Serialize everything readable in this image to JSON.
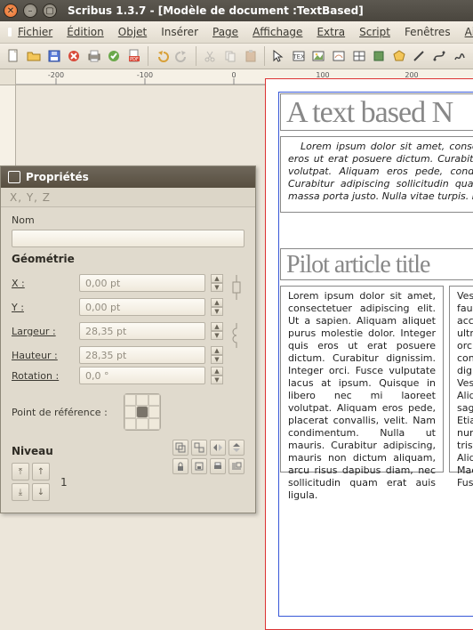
{
  "window": {
    "title": "Scribus 1.3.7 - [Modèle de document :TextBased]"
  },
  "menu": {
    "file": "Fichier",
    "edit": "Édition",
    "obj": "Objet",
    "insert": "Insérer",
    "page": "Page",
    "display": "Affichage",
    "extra": "Extra",
    "script": "Script",
    "windows": "Fenêtres",
    "help": "Aide"
  },
  "ruler": {
    "h": [
      "-200",
      "-100",
      "0",
      "100",
      "200"
    ]
  },
  "doc": {
    "heading": "A text based N",
    "intro": "Lorem ipsum dolor sit amet, consectetuer adipiscing elit, quis eros ut erat posuere dictum. Curabitur dignissim, nec mi laoreet volutpat. Aliquam eros pede, condimentum. Nulla ut mauris. Curabitur adipiscing sollicitudin quam erat quis ligula. Aenean massa porta justo. Nulla vitae turpis. Praesent lacus.",
    "h2": "Pilot article title",
    "col1": "Lorem ipsum dolor sit amet, consectetuer adipiscing elit. Ut a sapien. Aliquam aliquet purus molestie dolor. Integer quis eros ut erat posuere dictum. Curabitur dignissim. Integer orci. Fusce vulputate lacus at ipsum.  Quisque in libero nec mi laoreet volutpat. Aliquam eros pede, placerat convallis, velit. Nam condimentum. Nulla ut mauris. Curabitur adipiscing, mauris non dictum aliquam, arcu risus dapibus diam, nec sollicitudin quam erat auis ligula.",
    "col2": "Vestibulum in faucibus lorem accumsan ultricies mattis orci ut tristique consequat dignissim. Fusce  Vestibulum velit. Aliquam sed, sagittis nibh leo. Etiam hendrerit nunc. Vivamus tristique facilisis. Aliquam. Maecenas eget Fusce"
  },
  "prop": {
    "title": "Propriétés",
    "tabs": "X, Y, Z",
    "nom": "Nom",
    "geom": "Géométrie",
    "x": "X :",
    "y": "Y :",
    "w": "Largeur :",
    "h": "Hauteur :",
    "r": "Rotation :",
    "vx": "0,00 pt",
    "vy": "0,00 pt",
    "vw": "28,35 pt",
    "vh": "28,35 pt",
    "vr": "0,0 °",
    "ref": "Point de référence :",
    "niveau": "Niveau",
    "lvl": "1"
  }
}
